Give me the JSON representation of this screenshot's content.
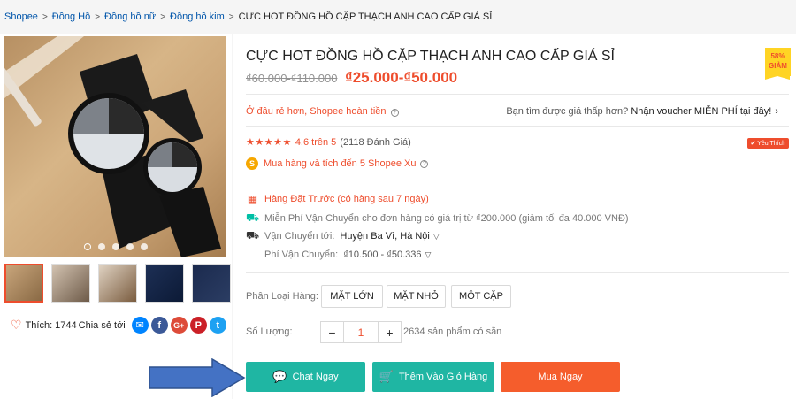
{
  "breadcrumb": [
    "Shopee",
    "Đồng Hồ",
    "Đồng hồ nữ",
    "Đồng hồ kim"
  ],
  "breadcrumb_current": "CỰC HOT ĐỒNG HỒ CẶP THẠCH ANH CAO CẤP GIÁ SỈ",
  "product": {
    "title": "CỰC HOT ĐỒNG HỒ CẶP THẠCH ANH CAO CẤP GIÁ SỈ",
    "badge_pct": "58%",
    "badge_text": "GIẢM",
    "old_price": "₫60.000-₫110.000",
    "price": "₫25.000-₫50.000"
  },
  "promo": {
    "cheaper_text": "Ở đâu rẻ hơn, Shopee hoàn tiền",
    "voucher_prefix": "Bạn tìm được giá thấp hơn?",
    "voucher_link": "Nhận voucher MIỄN PHÍ tại đây!"
  },
  "rating": {
    "value": "4.6 trên 5",
    "count": "(2118 Đánh Giá)",
    "stars": 4.6,
    "favorite": "Yêu Thích"
  },
  "xu": "Mua hàng và tích đến 5 Shopee Xu",
  "shipping": {
    "domestic": "Hàng Đặt Trước (có hàng sau 7 ngày)",
    "free": "Miễn Phí Vận Chuyển cho đơn hàng có giá trị từ ₫200.000 (giảm tối đa 40.000 VNĐ)",
    "dest_label": "Vận Chuyển tới:",
    "dest_value": "Huyện Ba Vì, Hà Nội",
    "fee_label": "Phí Vận Chuyển:",
    "fee_value": "₫10.500 - ₫50.336"
  },
  "variants": {
    "label": "Phân Loại Hàng:",
    "options": [
      "MẶT LỚN",
      "MẶT NHỎ",
      "MỘT CẶP"
    ]
  },
  "quantity": {
    "label": "Số Lượng:",
    "minus": "−",
    "value": "1",
    "plus": "+",
    "stock": "2634 sản phẩm có sẵn"
  },
  "buttons": {
    "chat": "Chat Ngay",
    "cart": "Thêm Vào Giỏ Hàng",
    "buy": "Mua Ngay"
  },
  "social": {
    "like": "Thích: 1744",
    "share": "Chia sẻ tới"
  },
  "gallery": {
    "dots": 5,
    "active_dot": 0,
    "active_thumb": 0
  },
  "colors": {
    "primary": "#ee4d2d",
    "teal": "#1fb6a3",
    "arrow": "#4472c4"
  }
}
